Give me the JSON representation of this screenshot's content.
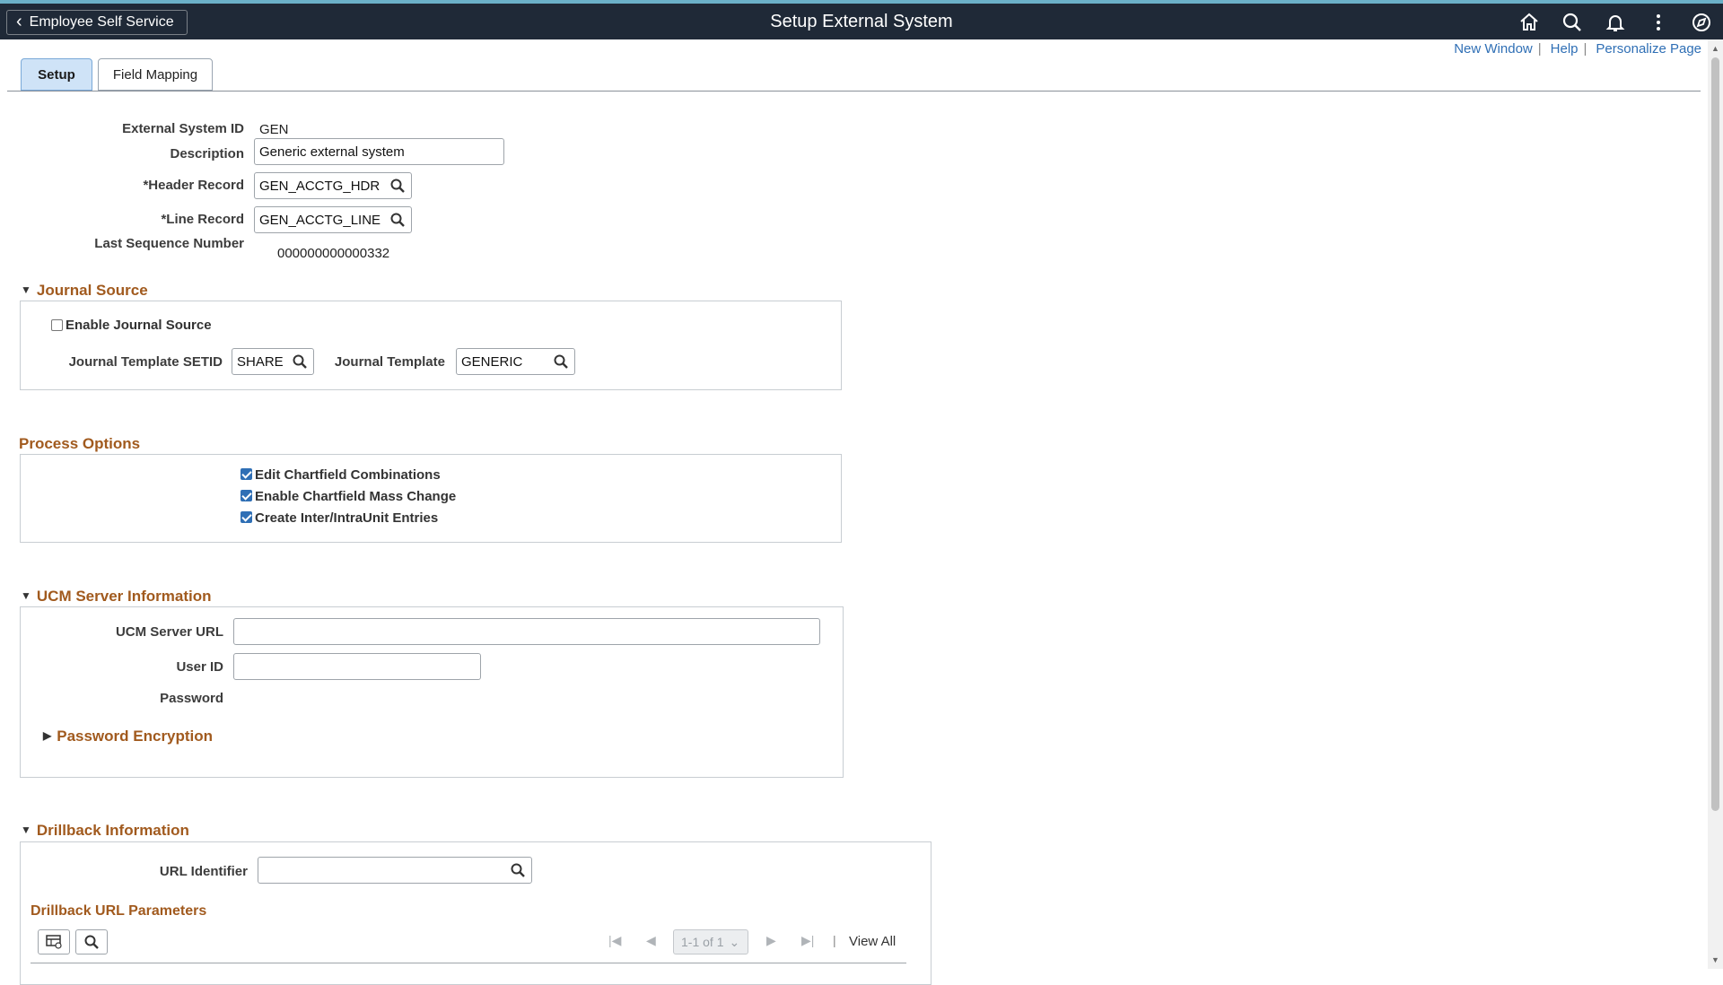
{
  "header": {
    "back_label": "Employee Self Service",
    "title": "Setup External System",
    "icons": [
      "home-icon",
      "search-icon",
      "bell-icon",
      "more-vertical-icon",
      "compass-icon"
    ]
  },
  "toplinks": {
    "new_window": "New Window",
    "help": "Help",
    "personalize": "Personalize Page",
    "separator": "|"
  },
  "tabs": [
    {
      "label": "Setup",
      "active": true
    },
    {
      "label": "Field Mapping",
      "active": false
    }
  ],
  "setup": {
    "external_system_id_label": "External System ID",
    "external_system_id": "GEN",
    "description_label": "Description",
    "description": "Generic external system",
    "header_record_label": "*Header Record",
    "header_record": "GEN_ACCTG_HDR",
    "line_record_label": "*Line Record",
    "line_record": "GEN_ACCTG_LINE",
    "last_sequence_label": "Last Sequence Number",
    "last_sequence": "000000000000332"
  },
  "journal_source": {
    "title": "Journal Source",
    "enable_label": "Enable Journal Source",
    "enable_checked": false,
    "template_setid_label": "Journal Template SETID",
    "template_setid": "SHARE",
    "template_label": "Journal Template",
    "template": "GENERIC"
  },
  "process_options": {
    "title": "Process Options",
    "options": [
      {
        "label": "Edit Chartfield Combinations",
        "checked": true
      },
      {
        "label": "Enable Chartfield Mass Change",
        "checked": true
      },
      {
        "label": "Create Inter/IntraUnit Entries",
        "checked": true
      }
    ]
  },
  "ucm": {
    "title": "UCM Server Information",
    "url_label": "UCM Server URL",
    "url": "",
    "user_label": "User ID",
    "user": "",
    "password_label": "Password",
    "encryption_label": "Password Encryption"
  },
  "drillback": {
    "title": "Drillback Information",
    "url_identifier_label": "URL Identifier",
    "url_identifier": "",
    "params_title": "Drillback URL Parameters",
    "pager": "1-1 of 1",
    "view_all": "View All"
  },
  "colors": {
    "header_bg": "#1f2937",
    "section_title": "#a15a1e",
    "link": "#2f6fb5",
    "active_tab": "#cfe3f7"
  }
}
